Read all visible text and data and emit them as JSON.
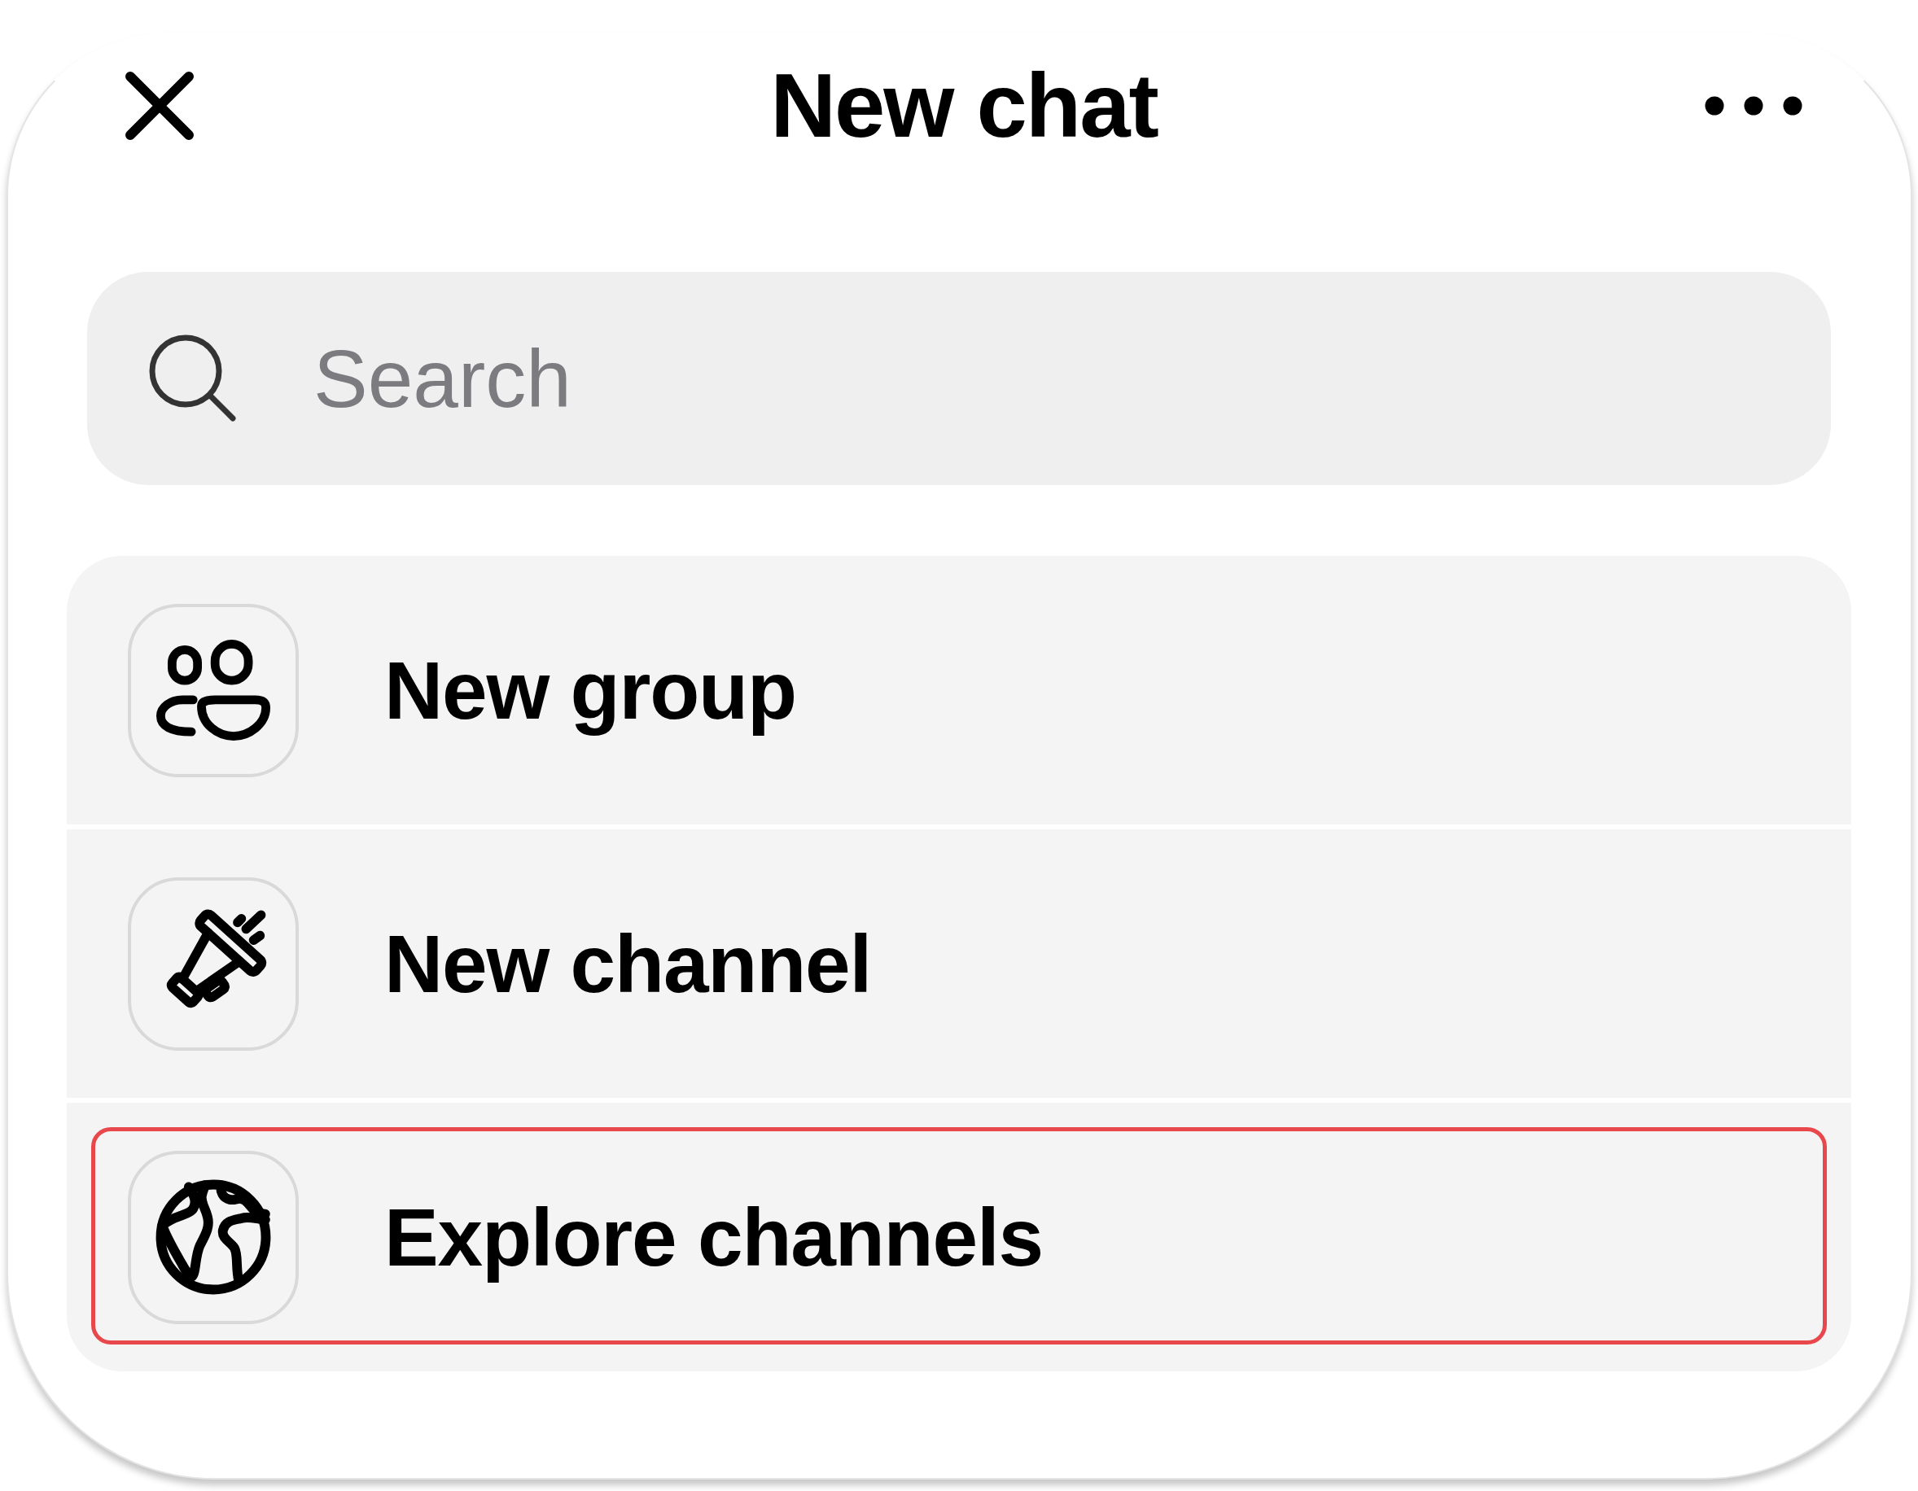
{
  "header": {
    "title": "New chat"
  },
  "search": {
    "placeholder": "Search"
  },
  "items": [
    {
      "kind": "group",
      "label": "New group",
      "highlighted": false
    },
    {
      "kind": "channel",
      "label": "New channel",
      "highlighted": false
    },
    {
      "kind": "explore",
      "label": "Explore channels",
      "highlighted": true
    }
  ]
}
